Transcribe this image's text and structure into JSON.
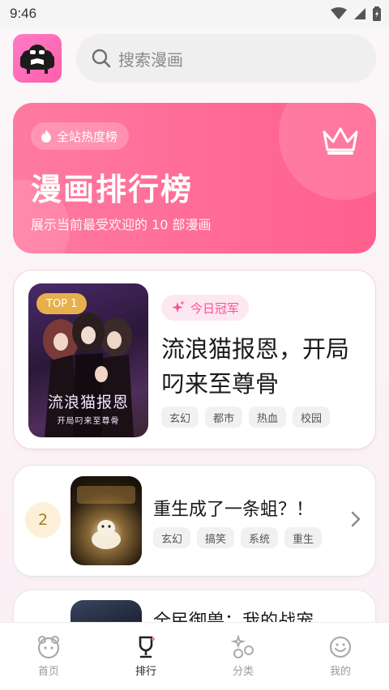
{
  "status_bar": {
    "time": "9:46"
  },
  "header": {
    "search_placeholder": "搜索漫画"
  },
  "hero": {
    "badge": "全站热度榜",
    "title": "漫画排行榜",
    "subtitle": "展示当前最受欢迎的 10 部漫画"
  },
  "rankings": [
    {
      "rank_label": "TOP 1",
      "highlight": "今日冠军",
      "title": "流浪猫报恩，开局叼来至尊骨",
      "cover_title": "流浪猫报恩",
      "cover_subtitle": "开局叼来至尊骨",
      "tags": [
        "玄幻",
        "都市",
        "热血",
        "校园"
      ]
    },
    {
      "rank": "2",
      "title": "重生成了一条蛆？！",
      "tags": [
        "玄幻",
        "搞笑",
        "系统",
        "重生"
      ]
    },
    {
      "title": "全民御兽：我的战宠"
    }
  ],
  "nav": {
    "items": [
      {
        "label": "首页"
      },
      {
        "label": "排行"
      },
      {
        "label": "分类"
      },
      {
        "label": "我的"
      }
    ]
  },
  "colors": {
    "accent": "#ff5f8e",
    "gold": "#e7b04c"
  }
}
